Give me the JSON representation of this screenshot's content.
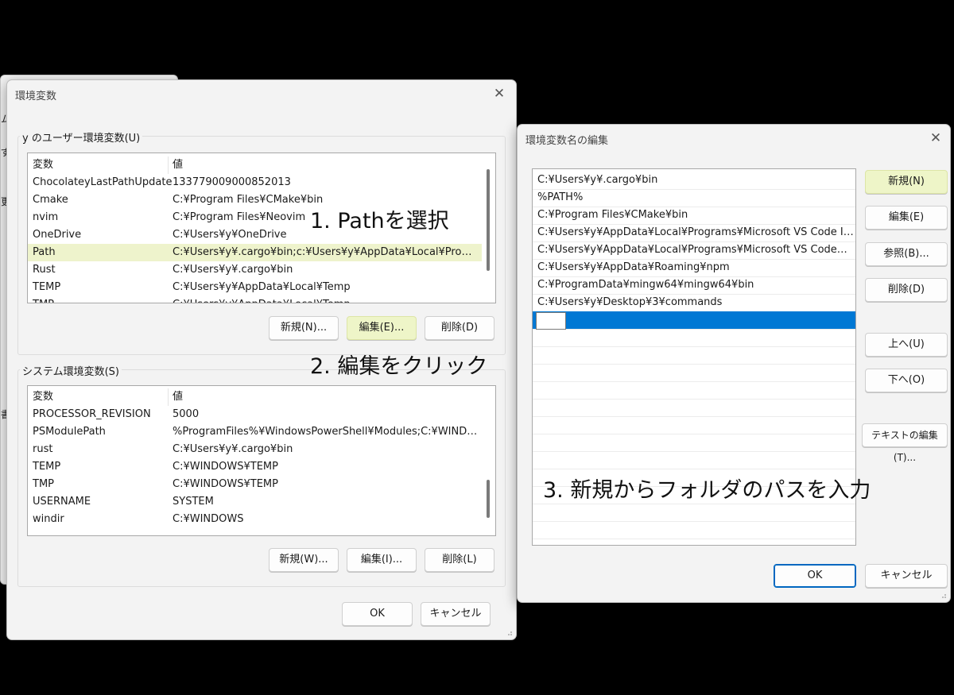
{
  "background_window": {
    "fragments": [
      "ム",
      "ず",
      "更",
      "書"
    ]
  },
  "env_dialog": {
    "title": "環境変数",
    "user_group": {
      "label": "y のユーザー環境変数(U)",
      "columns": [
        "変数",
        "値"
      ],
      "rows": [
        {
          "name": "ChocolateyLastPathUpdate",
          "value": "133779009000852013"
        },
        {
          "name": "Cmake",
          "value": "C:¥Program Files¥CMake¥bin"
        },
        {
          "name": "nvim",
          "value": "C:¥Program Files¥Neovim"
        },
        {
          "name": "OneDrive",
          "value": "C:¥Users¥y¥OneDrive"
        },
        {
          "name": "Path",
          "value": "C:¥Users¥y¥.cargo¥bin;c:¥Users¥y¥AppData¥Local¥Programs¥..."
        },
        {
          "name": "Rust",
          "value": "C:¥Users¥y¥.cargo¥bin"
        },
        {
          "name": "TEMP",
          "value": "C:¥Users¥y¥AppData¥Local¥Temp"
        },
        {
          "name": "TMP",
          "value": "C:¥Users¥y¥AppData¥Local¥Temp"
        }
      ],
      "selected_row": "Path",
      "buttons": {
        "new": "新規(N)...",
        "edit": "編集(E)...",
        "delete": "削除(D)"
      }
    },
    "system_group": {
      "label": "システム環境変数(S)",
      "columns": [
        "変数",
        "値"
      ],
      "rows": [
        {
          "name": "PROCESSOR_REVISION",
          "value": "5000"
        },
        {
          "name": "PSModulePath",
          "value": "%ProgramFiles%¥WindowsPowerShell¥Modules;C:¥WINDOW..."
        },
        {
          "name": "rust",
          "value": "C:¥Users¥y¥.cargo¥bin"
        },
        {
          "name": "TEMP",
          "value": "C:¥WINDOWS¥TEMP"
        },
        {
          "name": "TMP",
          "value": "C:¥WINDOWS¥TEMP"
        },
        {
          "name": "USERNAME",
          "value": "SYSTEM"
        },
        {
          "name": "windir",
          "value": "C:¥WINDOWS"
        }
      ],
      "buttons": {
        "new": "新規(W)...",
        "edit": "編集(I)...",
        "delete": "削除(L)"
      }
    },
    "ok": "OK",
    "cancel": "キャンセル"
  },
  "edit_dialog": {
    "title": "環境変数名の編集",
    "entries": [
      "C:¥Users¥y¥.cargo¥bin",
      "%PATH%",
      "C:¥Program Files¥CMake¥bin",
      "C:¥Users¥y¥AppData¥Local¥Programs¥Microsoft VS Code Insiders¥bin",
      "C:¥Users¥y¥AppData¥Local¥Programs¥Microsoft VS Code¥bin",
      "C:¥Users¥y¥AppData¥Roaming¥npm",
      "C:¥ProgramData¥mingw64¥mingw64¥bin",
      "C:¥Users¥y¥Desktop¥3¥commands"
    ],
    "new_entry_value": "",
    "buttons": {
      "new": "新規(N)",
      "edit": "編集(E)",
      "browse": "参照(B)...",
      "delete": "削除(D)",
      "up": "上へ(U)",
      "down": "下へ(O)",
      "edit_text": "テキストの編集(T)..."
    },
    "ok": "OK",
    "cancel": "キャンセル"
  },
  "annotations": {
    "step1": "1. Pathを選択",
    "step2": "2. 編集をクリック",
    "step3": "3. 新規からフォルダのパスを入力"
  },
  "colors": {
    "highlight": "#eef3cc",
    "selection": "#0078d4",
    "accent": "#0067c0"
  }
}
